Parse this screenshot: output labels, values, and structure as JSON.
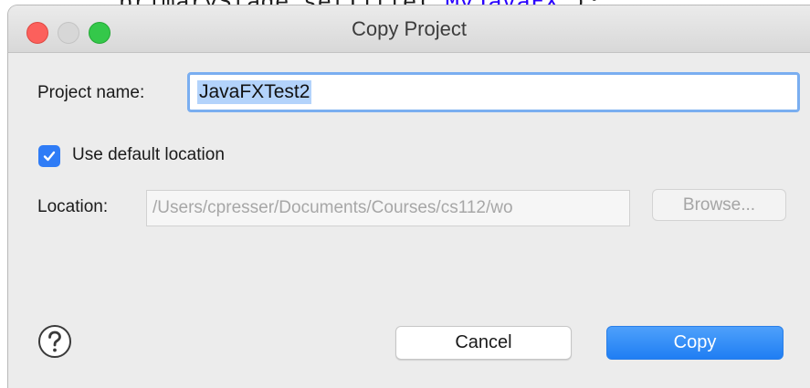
{
  "background": {
    "code_prefix": "primaryStage.setTitle(",
    "code_string": "\"MyJavaFX\"",
    "code_suffix": ");"
  },
  "dialog": {
    "title": "Copy Project",
    "project_name_label": "Project name:",
    "project_name_value": "JavaFXTest2",
    "use_default_location_label": "Use default location",
    "use_default_location_checked": true,
    "location_label": "Location:",
    "location_value": "/Users/cpresser/Documents/Courses/cs112/wo",
    "browse_label": "Browse...",
    "cancel_label": "Cancel",
    "copy_label": "Copy"
  },
  "icons": {
    "close": "close-window-icon",
    "minimize": "minimize-window-icon",
    "zoom": "zoom-window-icon",
    "checkbox": "checkmark-icon",
    "help": "question-mark-icon"
  },
  "colors": {
    "accent": "#2f7cf6",
    "close": "#fc605c",
    "zoom": "#34c84a",
    "disabled_text": "#a7a7a7"
  }
}
